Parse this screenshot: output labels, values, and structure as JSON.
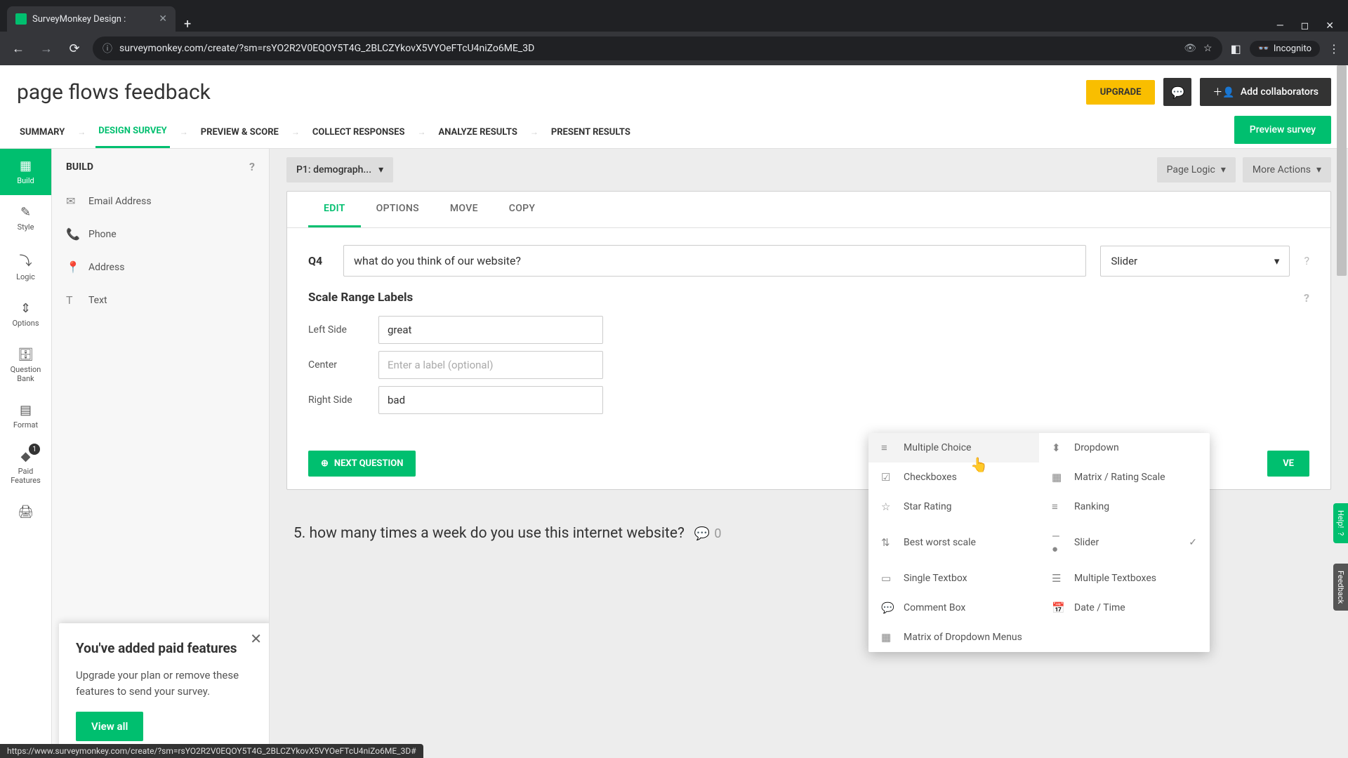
{
  "browser": {
    "tab_title": "SurveyMonkey Design :",
    "url": "surveymonkey.com/create/?sm=rsYO2R2V0EQOY5T4G_2BLCZYkovX5VYOeFTcU4niZo6ME_3D",
    "incognito_label": "Incognito"
  },
  "header": {
    "title": "page flows feedback",
    "upgrade": "UPGRADE",
    "collab": "Add collaborators"
  },
  "nav": {
    "summary": "SUMMARY",
    "design": "DESIGN SURVEY",
    "preview": "PREVIEW & SCORE",
    "collect": "COLLECT RESPONSES",
    "analyze": "ANALYZE RESULTS",
    "present": "PRESENT RESULTS",
    "preview_btn": "Preview survey"
  },
  "rail": {
    "build": "Build",
    "style": "Style",
    "logic": "Logic",
    "options": "Options",
    "bank": "Question Bank",
    "format": "Format",
    "paid": "Paid Features",
    "paid_badge": "1"
  },
  "build_panel": {
    "title": "BUILD",
    "items": {
      "email": "Email Address",
      "phone": "Phone",
      "address": "Address",
      "text": "Text"
    }
  },
  "upsell": {
    "title": "You've added paid features",
    "text": "Upgrade your plan or remove these features to send your survey.",
    "cta": "View all"
  },
  "canvas": {
    "page_selector": "P1: demograph...",
    "page_logic": "Page Logic",
    "more_actions": "More Actions"
  },
  "question": {
    "tabs": {
      "edit": "EDIT",
      "options": "OPTIONS",
      "move": "MOVE",
      "copy": "COPY"
    },
    "num": "Q4",
    "text": "what do you think of our website?",
    "type_selected": "Slider",
    "section_title": "Scale Range Labels",
    "left_label": "Left Side",
    "left_value": "great",
    "center_label": "Center",
    "center_placeholder": "Enter a label (optional)",
    "right_label": "Right Side",
    "right_value": "bad",
    "next_btn": "NEXT QUESTION",
    "save_btn": "VE"
  },
  "type_menu": {
    "multiple_choice": "Multiple Choice",
    "dropdown": "Dropdown",
    "checkboxes": "Checkboxes",
    "matrix": "Matrix / Rating Scale",
    "star": "Star Rating",
    "ranking": "Ranking",
    "best_worst": "Best worst scale",
    "slider": "Slider",
    "single_textbox": "Single Textbox",
    "multiple_textboxes": "Multiple Textboxes",
    "comment": "Comment Box",
    "datetime": "Date / Time",
    "matrix_dropdown": "Matrix of Dropdown Menus"
  },
  "preview_q5": {
    "text": "5. how many times a week do you use this internet website?",
    "comments": "0"
  },
  "float": {
    "help": "Help!",
    "feedback": "Feedback"
  },
  "status_url": "https://www.surveymonkey.com/create/?sm=rsYO2R2V0EQOY5T4G_2BLCZYkovX5VYOeFTcU4niZo6ME_3D#"
}
